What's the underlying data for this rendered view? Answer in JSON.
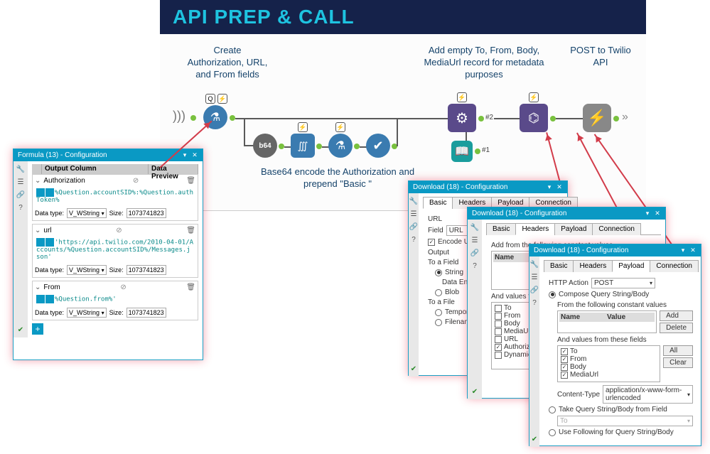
{
  "canvas": {
    "title": "API PREP & CALL",
    "steps": {
      "create": "Create\nAuthorization, URL,\nand From fields",
      "base64": "Base64 encode the Authorization and prepend \"Basic \"",
      "addempty": "Add empty To, From, Body, MediaUrl record for metadata purposes",
      "post": "POST to Twilio API"
    },
    "anchors": {
      "n1": "#1",
      "n2": "#2"
    }
  },
  "formula_win": {
    "title": "Formula (13) - Configuration",
    "headers": {
      "output": "Output Column",
      "preview": "Data Preview"
    },
    "fields": [
      {
        "name": "Authorization",
        "expr": "%Question.accountSID%:%Question.authToken%",
        "dt": "V_WString",
        "size": "1073741823"
      },
      {
        "name": "url",
        "expr": "'https://api.twilio.com/2010-04-01/Accounts/%Question.accountSID%/Messages.json'",
        "dt": "V_WString",
        "size": "1073741823"
      },
      {
        "name": "From",
        "expr": "%Question.from%'",
        "dt": "V_WString",
        "size": "1073741823"
      }
    ],
    "labels": {
      "data_type": "Data type:",
      "size": "Size:"
    }
  },
  "download": {
    "title": "Download (18) - Configuration",
    "tabs": {
      "basic": "Basic",
      "headers": "Headers",
      "payload": "Payload",
      "connection": "Connection"
    },
    "basic": {
      "url_label": "URL",
      "field_label": "Field",
      "encode_url": "Encode URL Text",
      "output_label": "Output",
      "to_field": "To a Field",
      "string": "String",
      "data_encoded": "Data Encoded As",
      "blob": "Blob",
      "to_file": "To a File",
      "temp": "Temporary File",
      "filename": "Filename from a Field"
    },
    "headers": {
      "add_constant": "Add from the following constant values",
      "col_name": "Name",
      "and_values": "And values from these fields",
      "items": [
        "To",
        "From",
        "Body",
        "MediaUrl",
        "URL",
        "Authorization",
        "Dynamic or Unknown"
      ],
      "checked": [
        false,
        false,
        false,
        false,
        false,
        true,
        false
      ]
    },
    "payload": {
      "http_action": "HTTP Action",
      "http_value": "POST",
      "compose": "Compose Query String/Body",
      "from_constant": "From the following constant values",
      "col_name": "Name",
      "col_value": "Value",
      "btn_add": "Add",
      "btn_delete": "Delete",
      "and_values": "And values from these fields",
      "items": [
        "To",
        "From",
        "Body",
        "MediaUrl"
      ],
      "btn_all": "All",
      "btn_clear": "Clear",
      "content_type": "Content-Type",
      "content_value": "application/x-www-form-urlencoded",
      "take_query": "Take Query String/Body from Field",
      "take_value": "To",
      "use_following": "Use Following for Query String/Body"
    }
  }
}
